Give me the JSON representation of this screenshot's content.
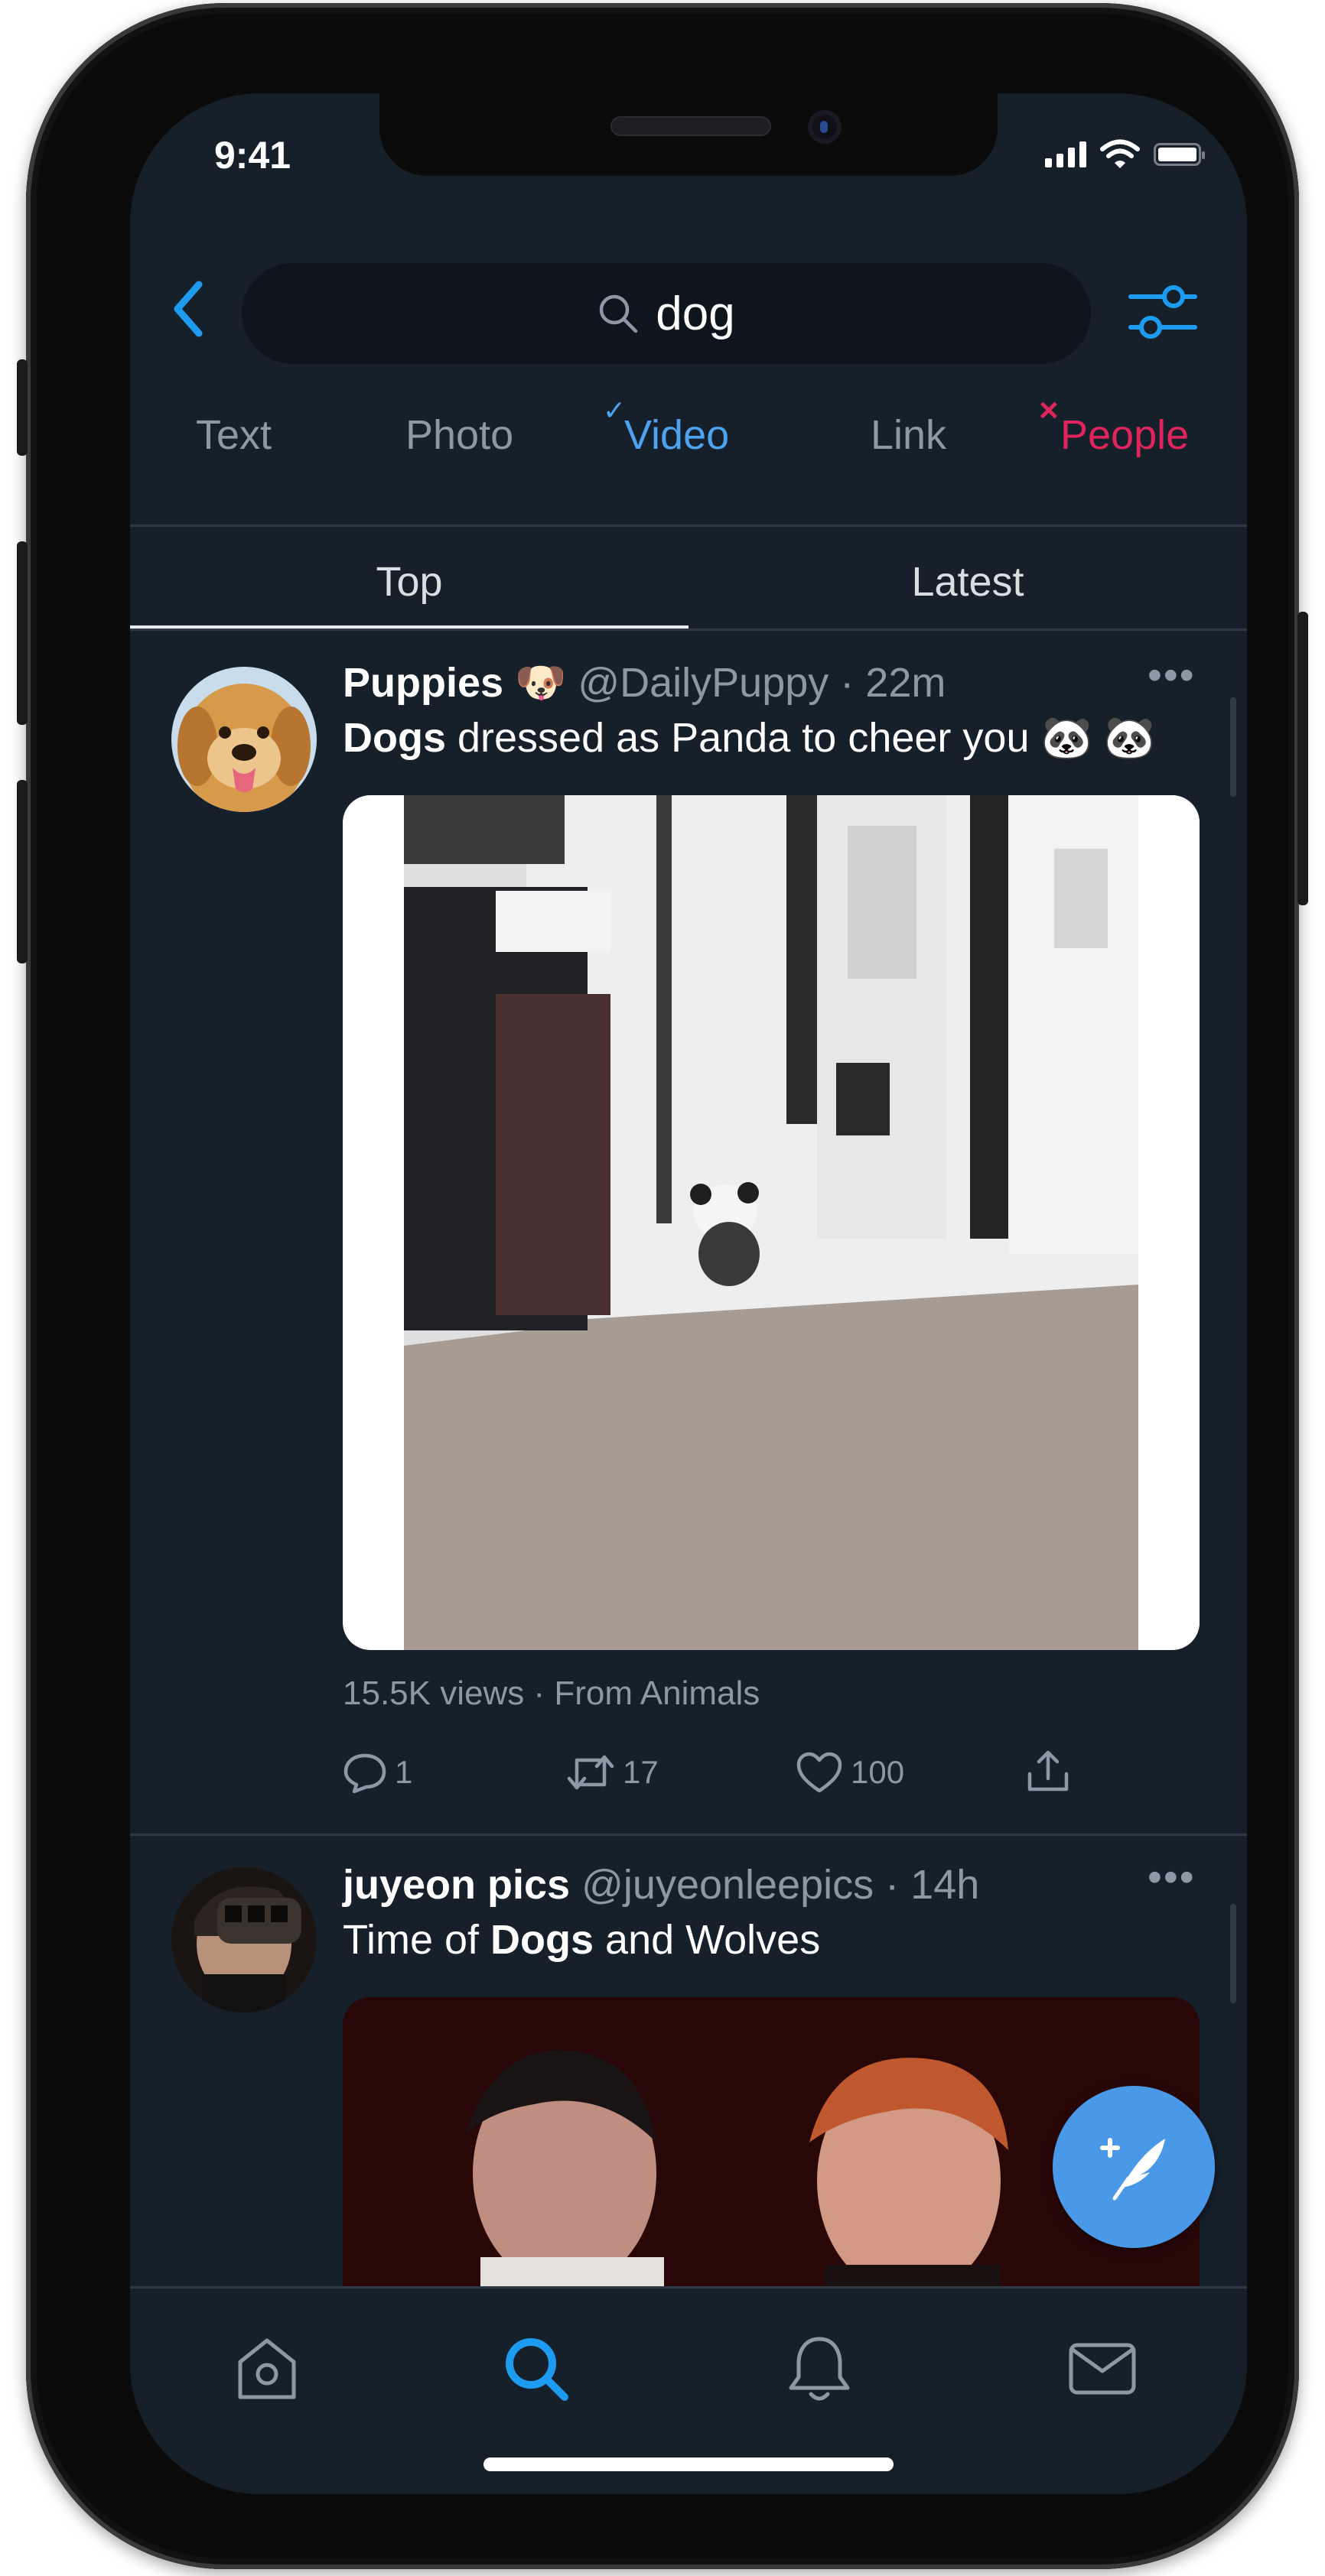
{
  "status_bar": {
    "time": "9:41"
  },
  "search": {
    "query": "dog"
  },
  "type_filters": [
    {
      "label": "Text",
      "state": "none"
    },
    {
      "label": "Photo",
      "state": "none"
    },
    {
      "label": "Video",
      "state": "included",
      "mark": "✓"
    },
    {
      "label": "Link",
      "state": "none"
    },
    {
      "label": "People",
      "state": "excluded",
      "mark": "×"
    }
  ],
  "sort_tabs": {
    "top": "Top",
    "latest": "Latest",
    "selected": "Top"
  },
  "tweets": [
    {
      "name": "Puppies",
      "name_emoji": "🐶",
      "handle": "@DailyPuppy",
      "separator": " · ",
      "time": "22m",
      "text_bold": "Dogs",
      "text_rest": " dressed as Panda to cheer you",
      "text_emoji": "🐼 🐼",
      "media_type": "video",
      "views": "15.5K views",
      "source": "From Animals",
      "meta_separator": " · ",
      "replies": "1",
      "retweets": "17",
      "likes": "100"
    },
    {
      "name": "juyeon pics",
      "handle": "@juyeonleepics",
      "separator": " · ",
      "time": "14h",
      "text_pre": "Time of ",
      "text_bold": "Dogs",
      "text_post": " and Wolves",
      "media_type": "video"
    }
  ],
  "more_label": "•••",
  "colors": {
    "background": "#15202b",
    "accent": "#4da3ee",
    "excluded": "#e0245e",
    "muted": "#8c98a6",
    "fab": "#4a99e9"
  },
  "icons": [
    "back-chevron-icon",
    "search-icon",
    "filter-sliders-icon",
    "reply-icon",
    "retweet-icon",
    "like-icon",
    "share-icon",
    "compose-tweet-icon",
    "home-icon",
    "explore-search-icon",
    "notifications-bell-icon",
    "messages-mail-icon"
  ]
}
